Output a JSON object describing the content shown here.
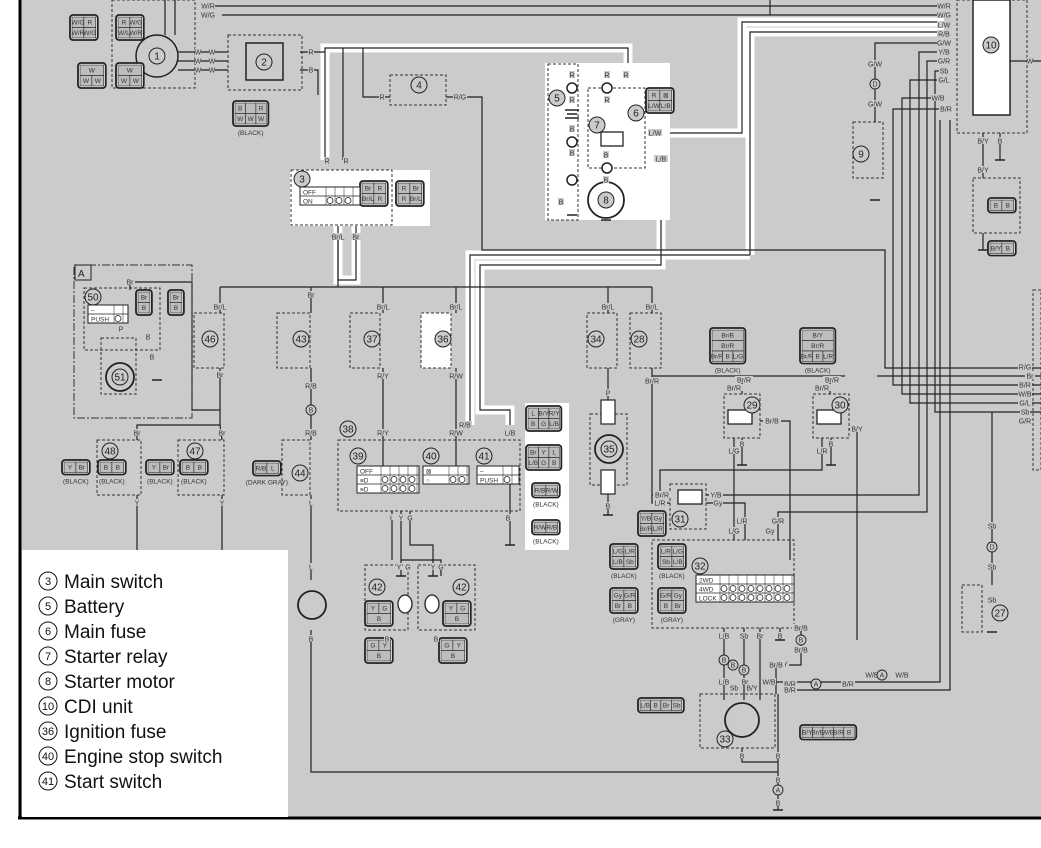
{
  "diagram_title": "",
  "box_label": "A",
  "legend": [
    {
      "num": "3",
      "label": "Main switch"
    },
    {
      "num": "5",
      "label": "Battery"
    },
    {
      "num": "6",
      "label": "Main fuse"
    },
    {
      "num": "7",
      "label": "Starter relay"
    },
    {
      "num": "8",
      "label": "Starter motor"
    },
    {
      "num": "10",
      "label": "CDI unit"
    },
    {
      "num": "36",
      "label": "Ignition fuse"
    },
    {
      "num": "40",
      "label": "Engine stop switch"
    },
    {
      "num": "41",
      "label": "Start switch"
    }
  ],
  "components": [
    "1",
    "2",
    "3",
    "4",
    "5",
    "6",
    "7",
    "8",
    "9",
    "10",
    "50",
    "51",
    "46",
    "43",
    "37",
    "36",
    "48",
    "47",
    "44",
    "38",
    "39",
    "40",
    "41",
    "34",
    "28",
    "35",
    "29",
    "30",
    "31",
    "32",
    "42",
    "42",
    "33",
    "27"
  ],
  "wire_labels": [
    "W/R",
    "W/G",
    "W",
    "W",
    "W",
    "W",
    "W",
    "W",
    "R",
    "B",
    "R",
    "R/G",
    "R",
    "R",
    "Br/L",
    "Br",
    "W/R",
    "W/G",
    "L/W",
    "R/B",
    "G/W",
    "Y/B",
    "G/R",
    "Sb",
    "G/L",
    "W/B",
    "B/R",
    "W",
    "G/W",
    "G/W",
    "B/Y",
    "B",
    "B/Y",
    "R",
    "R",
    "R",
    "R",
    "R",
    "B",
    "B",
    "B",
    "B",
    "B",
    "L/W",
    "L/B",
    "Br",
    "P",
    "B",
    "B",
    "Br/L",
    "Br",
    "Br",
    "R/B",
    "R/B",
    "L",
    "Br/L",
    "R/Y",
    "R/Y",
    "Br/L",
    "R/W",
    "R/W",
    "R/B",
    "L/B",
    "B",
    "L",
    "Y",
    "G",
    "Br",
    "Br",
    "Y",
    "Y",
    "Br/L",
    "Br/L",
    "P",
    "B",
    "Br/R",
    "Br/R",
    "Br/R",
    "Br/R",
    "Br/R",
    "Br/B",
    "B/Y",
    "L/G",
    "B",
    "L/R",
    "B",
    "R/G",
    "Br",
    "B/R",
    "W/B",
    "G/L",
    "Sb",
    "G/R",
    "Br/R",
    "L/R",
    "Y/B",
    "Gy",
    "L/R",
    "G/R",
    "L/G",
    "Gy",
    "Sb",
    "L",
    "Y",
    "G",
    "Y",
    "G",
    "B",
    "B",
    "B",
    "L/B",
    "Sb",
    "Br",
    "B",
    "Br/B",
    "Br/B",
    "B/Y",
    "Br/B",
    "L/B",
    "Sb",
    "Br",
    "B/Y",
    "W/B",
    "B/R",
    "W/B",
    "W/B",
    "B/R",
    "B/R",
    "B",
    "B",
    "B",
    "B",
    "Sb",
    "Sb"
  ],
  "markers": [
    "B",
    "B",
    "B",
    "B",
    "B",
    "A",
    "A",
    "A",
    "D",
    "D"
  ],
  "connectors": [
    {
      "cells": [
        [
          "W/G",
          "R"
        ],
        [
          "W/R",
          "W/G"
        ]
      ],
      "note": ""
    },
    {
      "cells": [
        [
          "R",
          "W/G"
        ],
        [
          "W/L",
          "W/R"
        ]
      ],
      "note": ""
    },
    {
      "cells": [
        [
          "W"
        ],
        [
          "W",
          "W"
        ]
      ],
      "note": ""
    },
    {
      "cells": [
        [
          "W"
        ],
        [
          "W",
          "W"
        ]
      ],
      "note": ""
    },
    {
      "cells": [
        [
          "B",
          "",
          "R"
        ],
        [
          "W",
          "W",
          "W"
        ]
      ],
      "note": "(BLACK)"
    },
    {
      "cells": [
        [
          "Br",
          "R"
        ],
        [
          "Br/L",
          "R"
        ]
      ],
      "note": ""
    },
    {
      "cells": [
        [
          "R",
          "Br"
        ],
        [
          "R",
          "Br/L"
        ]
      ],
      "note": ""
    },
    {
      "cells": [
        [
          "R",
          "⊠"
        ],
        [
          "L/W",
          "L/B"
        ]
      ],
      "note": ""
    },
    {
      "cells": [
        [
          "Br"
        ],
        [
          "B"
        ]
      ],
      "note": ""
    },
    {
      "cells": [
        [
          "Br"
        ],
        [
          "B"
        ]
      ],
      "note": ""
    },
    {
      "cells": [
        [
          "Y",
          "Br"
        ]
      ],
      "note": "(BLACK)"
    },
    {
      "cells": [
        [
          "B",
          "B"
        ]
      ],
      "note": "(BLACK)"
    },
    {
      "cells": [
        [
          "Y",
          "Br"
        ]
      ],
      "note": "(BLACK)"
    },
    {
      "cells": [
        [
          "B",
          "B"
        ]
      ],
      "note": "(BLACK)"
    },
    {
      "cells": [
        [
          "R/B",
          "L"
        ]
      ],
      "note": "(DARK GRAY)"
    },
    {
      "cells": [
        [
          "L",
          "B/Y",
          "R/Y"
        ],
        [
          "B",
          "G",
          "L/B"
        ]
      ],
      "note": ""
    },
    {
      "cells": [
        [
          "Br",
          "Y",
          "L"
        ],
        [
          "L/B",
          "G",
          "B"
        ]
      ],
      "note": ""
    },
    {
      "cells": [
        [
          "R/B",
          "R/W"
        ]
      ],
      "note": "(BLACK)"
    },
    {
      "cells": [
        [
          "R/W",
          "R/B"
        ]
      ],
      "note": "(BLACK)"
    },
    {
      "cells": [
        [
          "Br/B"
        ],
        [
          "Br/R"
        ],
        [
          "Br/R",
          "B",
          "L/G"
        ]
      ],
      "note": "(BLACK)"
    },
    {
      "cells": [
        [
          "B/Y"
        ],
        [
          "Br/R"
        ],
        [
          "Br/R",
          "B",
          "L/R"
        ]
      ],
      "note": "(BLACK)"
    },
    {
      "cells": [
        [
          "Y/B",
          "Gy"
        ],
        [
          "Br/R",
          "L/R"
        ]
      ],
      "note": ""
    },
    {
      "cells": [
        [
          "L/G",
          "L/R"
        ],
        [
          "L/B",
          "Sb"
        ]
      ],
      "note": "(BLACK)"
    },
    {
      "cells": [
        [
          "Gy",
          "G/R"
        ],
        [
          "Br",
          "B"
        ]
      ],
      "note": "(GRAY)"
    },
    {
      "cells": [
        [
          "L/R",
          "L/G"
        ],
        [
          "Sb",
          "L/B"
        ]
      ],
      "note": "(BLACK)"
    },
    {
      "cells": [
        [
          "G/R",
          "Gy"
        ],
        [
          "B",
          "Br"
        ]
      ],
      "note": "(GRAY)"
    },
    {
      "cells": [
        [
          "L/B",
          "B",
          "Br",
          "Sb"
        ]
      ],
      "note": ""
    },
    {
      "cells": [
        [
          "B/Y",
          "Br/B",
          "W/B",
          "B/R",
          "B"
        ]
      ],
      "note": ""
    },
    {
      "cells": [
        [
          "B",
          "B"
        ]
      ],
      "note": ""
    },
    {
      "cells": [
        [
          "B/Y",
          "B"
        ]
      ],
      "note": ""
    },
    {
      "cells": [
        [
          "Y",
          "G"
        ],
        [
          "B"
        ]
      ],
      "note": ""
    },
    {
      "cells": [
        [
          "Y",
          "G"
        ],
        [
          "B"
        ]
      ],
      "note": ""
    },
    {
      "cells": [
        [
          "G",
          "Y"
        ],
        [
          "B"
        ]
      ],
      "note": ""
    },
    {
      "cells": [
        [
          "G",
          "Y"
        ],
        [
          "B"
        ]
      ],
      "note": ""
    }
  ],
  "switch_tables": [
    {
      "name": "main-switch-table",
      "rows": [
        "OFF",
        "ON"
      ]
    },
    {
      "name": "switch-50-table",
      "rows": [
        "–",
        "PUSH"
      ]
    },
    {
      "name": "lights-switch-table",
      "rows": [
        "OFF",
        "≡D",
        "≡D"
      ]
    },
    {
      "name": "engine-stop-switch-table",
      "rows": [
        "⊠",
        "○"
      ]
    },
    {
      "name": "start-switch-table",
      "rows": [
        "–",
        "PUSH"
      ]
    },
    {
      "name": "drive-select-switch-table",
      "rows": [
        "2WD",
        "4WD",
        "LOCK"
      ]
    }
  ],
  "colors": {
    "background": "#cbcbcb",
    "highlight": "#ffffff",
    "line": "#222222",
    "legend_bg": "#ffffff"
  }
}
